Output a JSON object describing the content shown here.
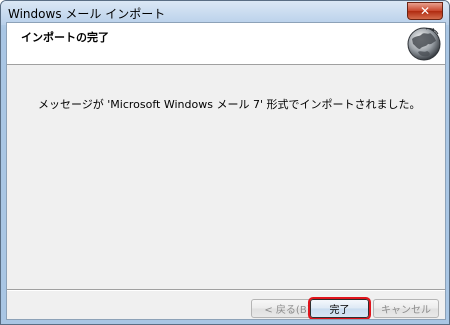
{
  "window": {
    "title": "Windows メール インポート"
  },
  "header": {
    "title": "インポートの完了"
  },
  "main": {
    "message": "メッセージが 'Microsoft Windows メール 7' 形式でインポートされました。"
  },
  "buttons": {
    "back_label": "< 戻る(B)",
    "finish_label": "完了",
    "cancel_label": "キャンセル"
  },
  "colors": {
    "focus_highlight": "#e0141b",
    "close_button": "#c8452c",
    "client_background": "#f0f0f0"
  },
  "icons": {
    "close": "close-icon",
    "wizard": "globe-icon"
  }
}
